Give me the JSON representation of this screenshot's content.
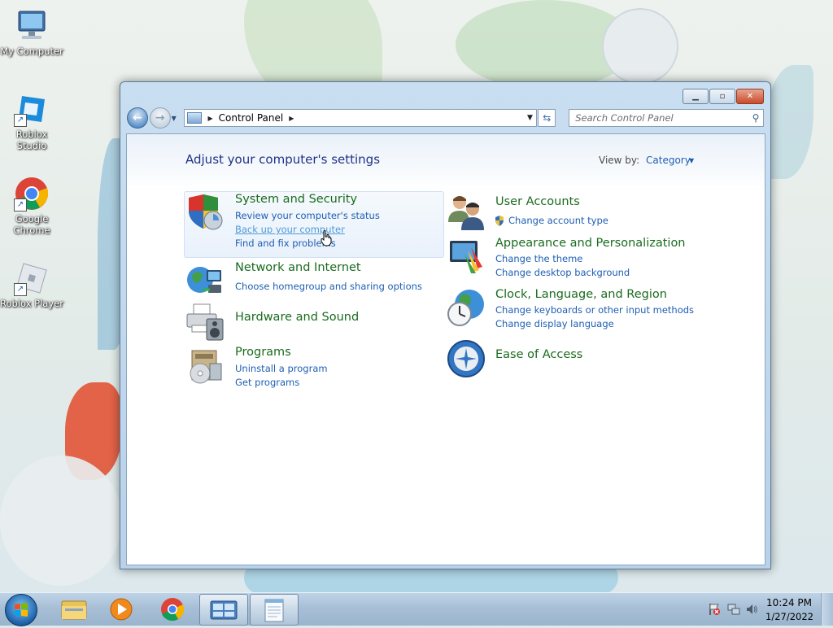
{
  "desktop": {
    "icons": [
      {
        "label": "My Computer"
      },
      {
        "label": "Roblox Studio"
      },
      {
        "label": "Google Chrome"
      },
      {
        "label": "Roblox Player"
      }
    ]
  },
  "window": {
    "caption_buttons": {
      "minimize": "▁",
      "maximize": "▫",
      "close": "✕"
    },
    "address": {
      "crumbs": [
        "Control Panel"
      ]
    },
    "search": {
      "placeholder": "Search Control Panel"
    },
    "heading": "Adjust your computer's settings",
    "view_by": {
      "label": "View by:",
      "value": "Category"
    },
    "categories_left": [
      {
        "title": "System and Security",
        "links": [
          "Review your computer's status",
          "Back up your computer",
          "Find and fix problems"
        ],
        "icon": "shield-icon"
      },
      {
        "title": "Network and Internet",
        "links": [
          "Choose homegroup and sharing options"
        ],
        "icon": "network-icon"
      },
      {
        "title": "Hardware and Sound",
        "links": [],
        "icon": "printer-icon"
      },
      {
        "title": "Programs",
        "links": [
          "Uninstall a program",
          "Get programs"
        ],
        "icon": "programs-icon"
      }
    ],
    "categories_right": [
      {
        "title": "User Accounts",
        "links": [
          "Change account type"
        ],
        "icon": "users-icon"
      },
      {
        "title": "Appearance and Personalization",
        "links": [
          "Change the theme",
          "Change desktop background"
        ],
        "icon": "appearance-icon"
      },
      {
        "title": "Clock, Language, and Region",
        "links": [
          "Change keyboards or other input methods",
          "Change display language"
        ],
        "icon": "clock-globe-icon"
      },
      {
        "title": "Ease of Access",
        "links": [],
        "icon": "ease-of-access-icon"
      }
    ]
  },
  "taskbar": {
    "pinned": [
      "start-orb",
      "file-explorer-icon",
      "media-player-icon",
      "chrome-icon",
      "control-panel-icon",
      "notepad-icon"
    ],
    "clock": {
      "time": "10:24 PM",
      "date": "1/27/2022"
    }
  },
  "colors": {
    "category_title": "#1a6b1e",
    "link": "#1e5eb3",
    "heading": "#1e3287"
  }
}
